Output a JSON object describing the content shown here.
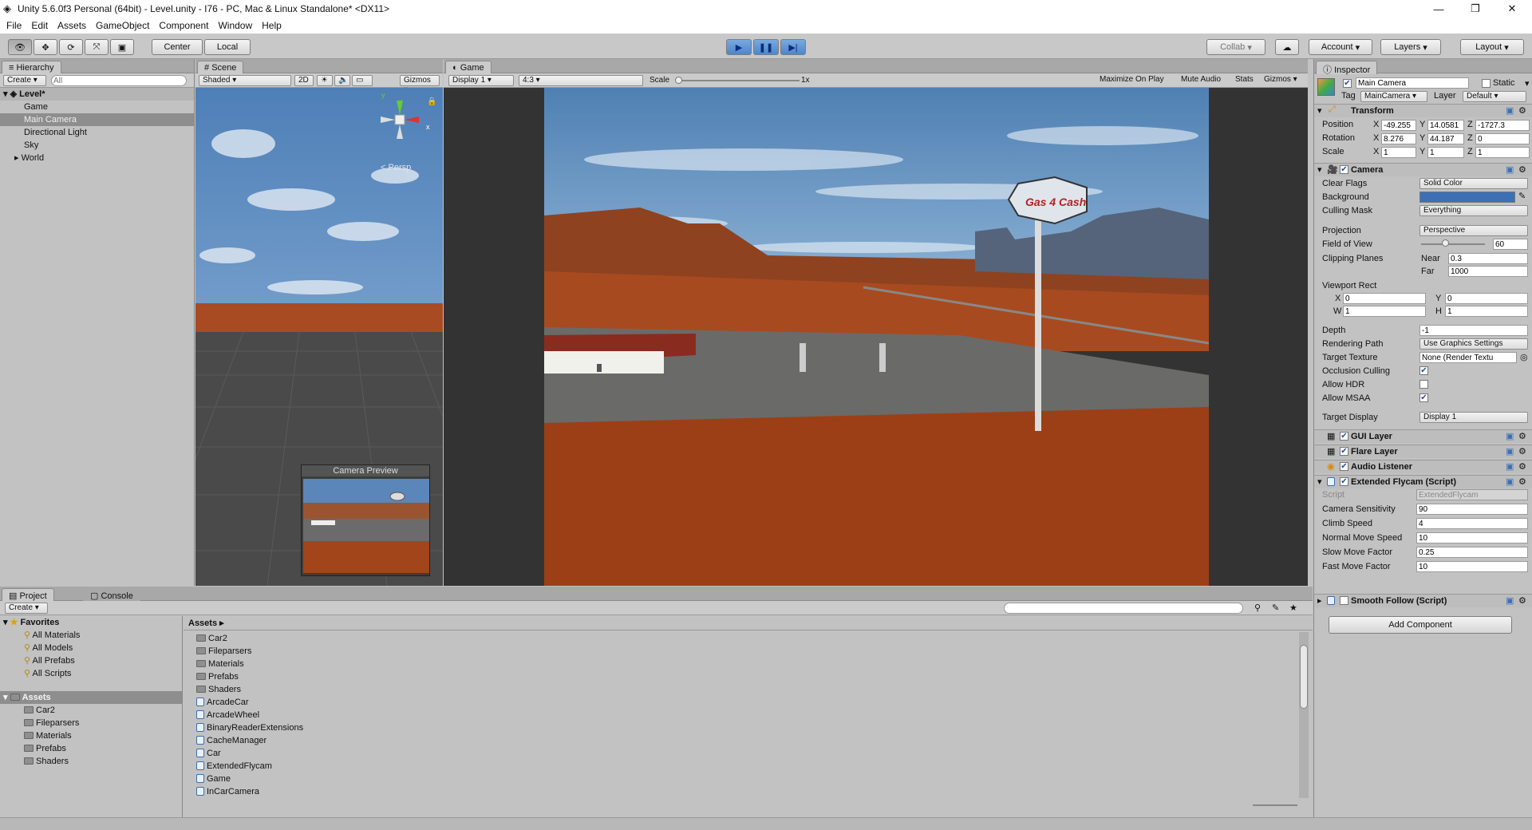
{
  "window": {
    "title": "Unity 5.6.0f3 Personal (64bit) - Level.unity - I76 - PC, Mac & Linux Standalone* <DX11>",
    "minimize": "—",
    "maximize": "❐",
    "close": "✕"
  },
  "menu": [
    "File",
    "Edit",
    "Assets",
    "GameObject",
    "Component",
    "Window",
    "Help"
  ],
  "toolbar": {
    "center": "Center",
    "local": "Local",
    "collab": "Collab",
    "account": "Account",
    "layers": "Layers",
    "layout": "Layout"
  },
  "hierarchy": {
    "tab": "Hierarchy",
    "create": "Create",
    "search_placeholder": "All",
    "scene": "Level*",
    "items": [
      "Game",
      "Main Camera",
      "Directional Light",
      "Sky",
      "World"
    ]
  },
  "scene": {
    "tab": "Scene",
    "shading": "Shaded",
    "mode2d": "2D",
    "gizmos": "Gizmos",
    "persp": "Persp",
    "camera_preview": "Camera Preview"
  },
  "game": {
    "tab": "Game",
    "display": "Display 1",
    "aspect": "4:3",
    "scale_label": "Scale",
    "scale_value": "1x",
    "maximize": "Maximize On Play",
    "mute": "Mute Audio",
    "stats": "Stats",
    "gizmos": "Gizmos",
    "sign_text": "Gas 4 Cash"
  },
  "inspector": {
    "tab": "Inspector",
    "object_name": "Main Camera",
    "static": "Static",
    "tag_label": "Tag",
    "tag": "MainCamera",
    "layer_label": "Layer",
    "layer": "Default",
    "transform": {
      "title": "Transform",
      "position": "Position",
      "rotation": "Rotation",
      "scale": "Scale",
      "px": "-49.255",
      "py": "14.0581",
      "pz": "-1727.3",
      "rx": "8.276",
      "ry": "44.187",
      "rz": "0",
      "sx": "1",
      "sy": "1",
      "sz": "1"
    },
    "camera": {
      "title": "Camera",
      "clear_flags": "Clear Flags",
      "clear_flags_v": "Solid Color",
      "background": "Background",
      "culling": "Culling Mask",
      "culling_v": "Everything",
      "projection": "Projection",
      "projection_v": "Perspective",
      "fov": "Field of View",
      "fov_v": "60",
      "clipping": "Clipping Planes",
      "near": "Near",
      "near_v": "0.3",
      "far": "Far",
      "far_v": "1000",
      "viewport": "Viewport Rect",
      "vx": "0",
      "vy": "0",
      "vw": "1",
      "vh": "1",
      "depth": "Depth",
      "depth_v": "-1",
      "rendering": "Rendering Path",
      "rendering_v": "Use Graphics Settings",
      "target_tex": "Target Texture",
      "target_tex_v": "None (Render Textu",
      "occlusion": "Occlusion Culling",
      "hdr": "Allow HDR",
      "msaa": "Allow MSAA",
      "target_display": "Target Display",
      "target_display_v": "Display 1"
    },
    "gui_layer": "GUI Layer",
    "flare_layer": "Flare Layer",
    "audio_listener": "Audio Listener",
    "flycam": {
      "title": "Extended Flycam (Script)",
      "script": "Script",
      "script_v": "ExtendedFlycam",
      "sens": "Camera Sensitivity",
      "sens_v": "90",
      "climb": "Climb Speed",
      "climb_v": "4",
      "normal": "Normal Move Speed",
      "normal_v": "10",
      "slow": "Slow Move Factor",
      "slow_v": "0.25",
      "fast": "Fast Move Factor",
      "fast_v": "10"
    },
    "smooth": "Smooth Follow (Script)",
    "add_component": "Add Component"
  },
  "project": {
    "tab": "Project",
    "console_tab": "Console",
    "create": "Create",
    "favorites": "Favorites",
    "fav_items": [
      "All Materials",
      "All Models",
      "All Prefabs",
      "All Scripts"
    ],
    "assets_root": "Assets",
    "tree": [
      "Car2",
      "Fileparsers",
      "Materials",
      "Prefabs",
      "Shaders"
    ],
    "breadcrumb": "Assets",
    "folders": [
      "Car2",
      "Fileparsers",
      "Materials",
      "Prefabs",
      "Shaders"
    ],
    "scripts": [
      "ArcadeCar",
      "ArcadeWheel",
      "BinaryReaderExtensions",
      "CacheManager",
      "Car",
      "ExtendedFlycam",
      "Game",
      "InCarCamera"
    ]
  },
  "colors": {
    "accent_blue": "#3d6fb5",
    "panel": "#c2c2c2",
    "selected": "#8e8e8e"
  }
}
